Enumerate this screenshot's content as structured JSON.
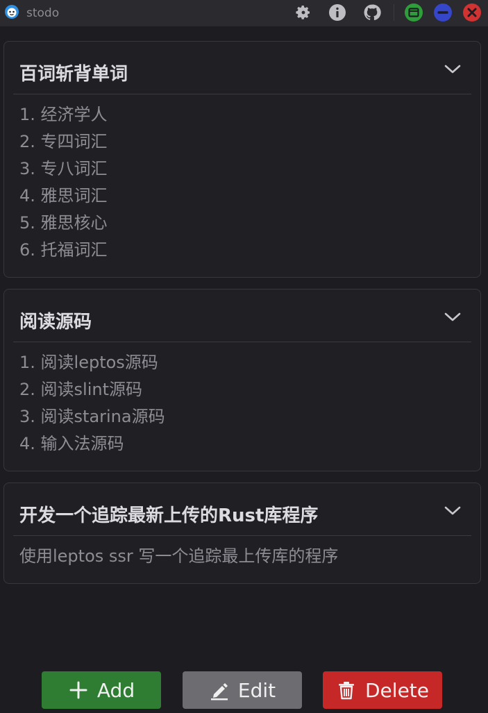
{
  "window": {
    "title": "stodo",
    "controls": {
      "settings_icon": "gear-icon",
      "info_icon": "info-icon",
      "github_icon": "github-icon",
      "maximize_color": "#2e9e3a",
      "minimize_color": "#3546c9",
      "close_color": "#d13232"
    }
  },
  "todos": [
    {
      "title": "百词斩背单词",
      "items": [
        "1. 经济学人",
        "2. 专四词汇",
        "3. 专八词汇",
        "4. 雅思词汇",
        "5. 雅思核心",
        "6. 托福词汇"
      ]
    },
    {
      "title": "阅读源码",
      "items": [
        "1. 阅读leptos源码",
        "2. 阅读slint源码",
        "3. 阅读starina源码",
        "4. 输入法源码"
      ]
    },
    {
      "title": "开发一个追踪最新上传的Rust库程序",
      "items": [
        "使用leptos ssr 写一个追踪最上传库的程序"
      ]
    }
  ],
  "footer": {
    "add_label": "Add",
    "edit_label": "Edit",
    "delete_label": "Delete",
    "add_color": "#2e7d32",
    "edit_color": "#6c6c71",
    "delete_color": "#c62828"
  }
}
